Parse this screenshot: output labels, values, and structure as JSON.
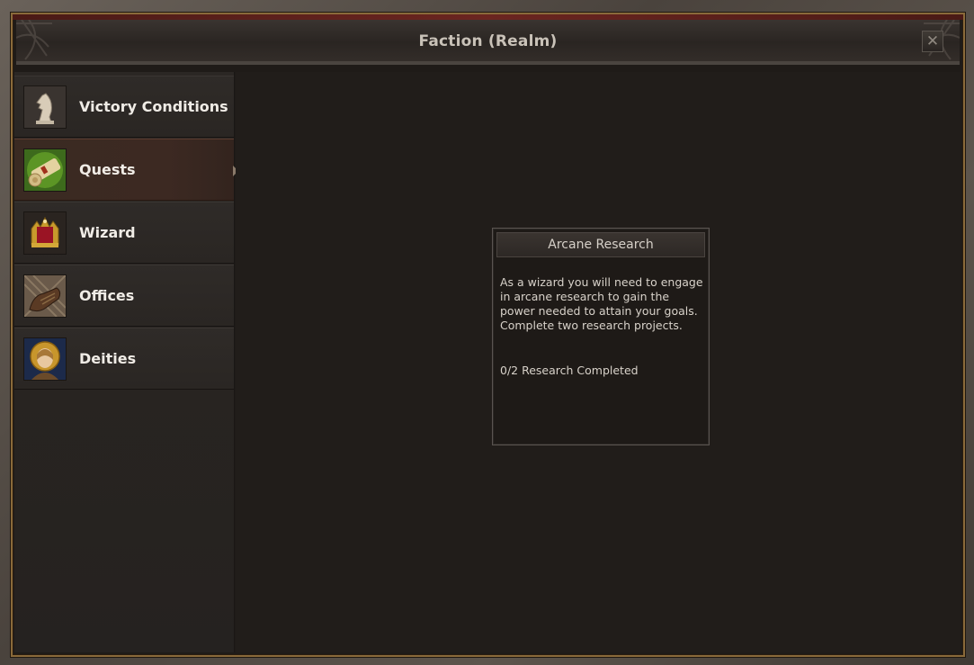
{
  "window": {
    "title": "Faction (Realm)",
    "close_label": "✕"
  },
  "sidebar": {
    "items": [
      {
        "label": "Victory Conditions",
        "icon": "knight-chess-icon",
        "active": false
      },
      {
        "label": "Quests",
        "icon": "scroll-icon",
        "active": true
      },
      {
        "label": "Wizard",
        "icon": "crown-icon",
        "active": false
      },
      {
        "label": "Offices",
        "icon": "gauntlet-icon",
        "active": false
      },
      {
        "label": "Deities",
        "icon": "saint-portrait-icon",
        "active": false
      }
    ]
  },
  "quest_card": {
    "title": "Arcane Research",
    "description": "As a wizard you will need to engage in arcane research to gain the power needed to attain your goals. Complete two research projects.",
    "progress": "0/2 Research Completed"
  },
  "colors": {
    "frame_gold": "#8a6a3a",
    "panel_bg": "#211d1a",
    "text_light": "#f0ece6"
  }
}
